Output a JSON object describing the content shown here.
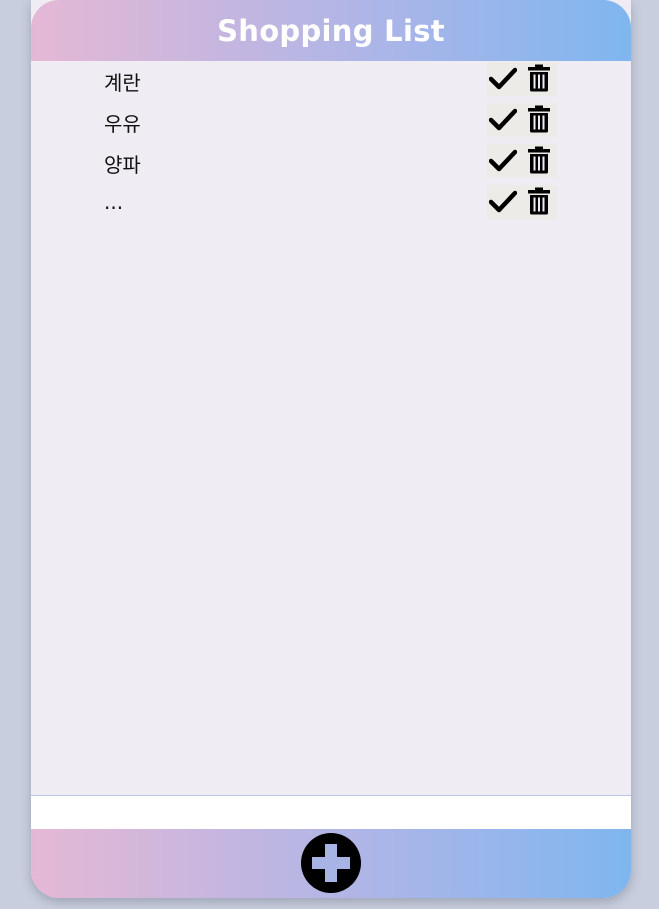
{
  "header": {
    "title": "Shopping List"
  },
  "items": [
    {
      "label": "계란"
    },
    {
      "label": "우유"
    },
    {
      "label": "양파"
    },
    {
      "label": "..."
    }
  ],
  "input": {
    "value": "",
    "placeholder": ""
  },
  "icons": {
    "done": "check-icon",
    "delete": "trash-icon",
    "add": "plus-circle-icon"
  },
  "colors": {
    "gradient_start": "#e5b8d5",
    "gradient_mid": "#aab5e8",
    "gradient_end": "#7fb6ef",
    "list_background": "#efedf3",
    "page_background": "#c8cedd"
  }
}
